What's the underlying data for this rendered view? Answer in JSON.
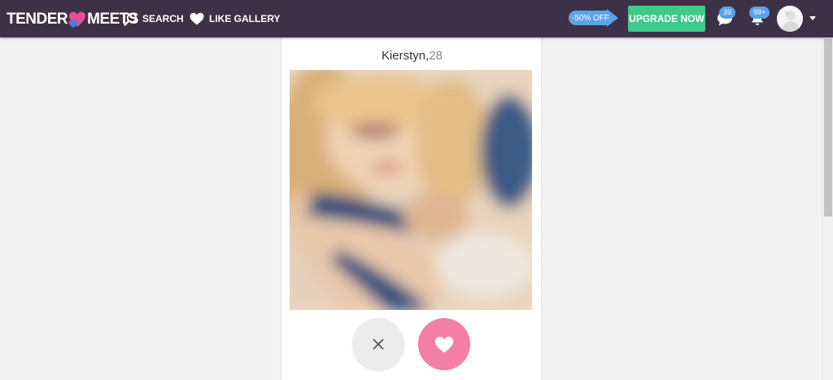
{
  "brand": {
    "logo_left": "TENDER",
    "logo_right": "MEETS",
    "colors": {
      "header": "#3d3148",
      "heart_pink": "#e84c9a",
      "heart_blue": "#4d7fd6",
      "upgrade": "#3fc98a",
      "badge": "#5aa3e6",
      "like": "#f47fa6"
    }
  },
  "nav": {
    "search": {
      "label": "SEARCH",
      "icon": "search-icon"
    },
    "like_gallery": {
      "label": "LIKE GALLERY",
      "icon": "heart-icon"
    }
  },
  "promo": {
    "discount_label": "-50% OFF",
    "upgrade_label": "UPGRADE NOW"
  },
  "notifications": {
    "messages": {
      "icon": "chat-bubble-icon",
      "count": "39"
    },
    "alerts": {
      "icon": "bell-icon",
      "count": "99+"
    }
  },
  "user_menu": {
    "avatar_icon": "avatar",
    "caret_icon": "caret-down-icon"
  },
  "profile": {
    "name": "Kierstyn,",
    "age": "28"
  },
  "actions": {
    "pass": {
      "icon": "close-icon"
    },
    "like": {
      "icon": "heart-icon"
    }
  }
}
